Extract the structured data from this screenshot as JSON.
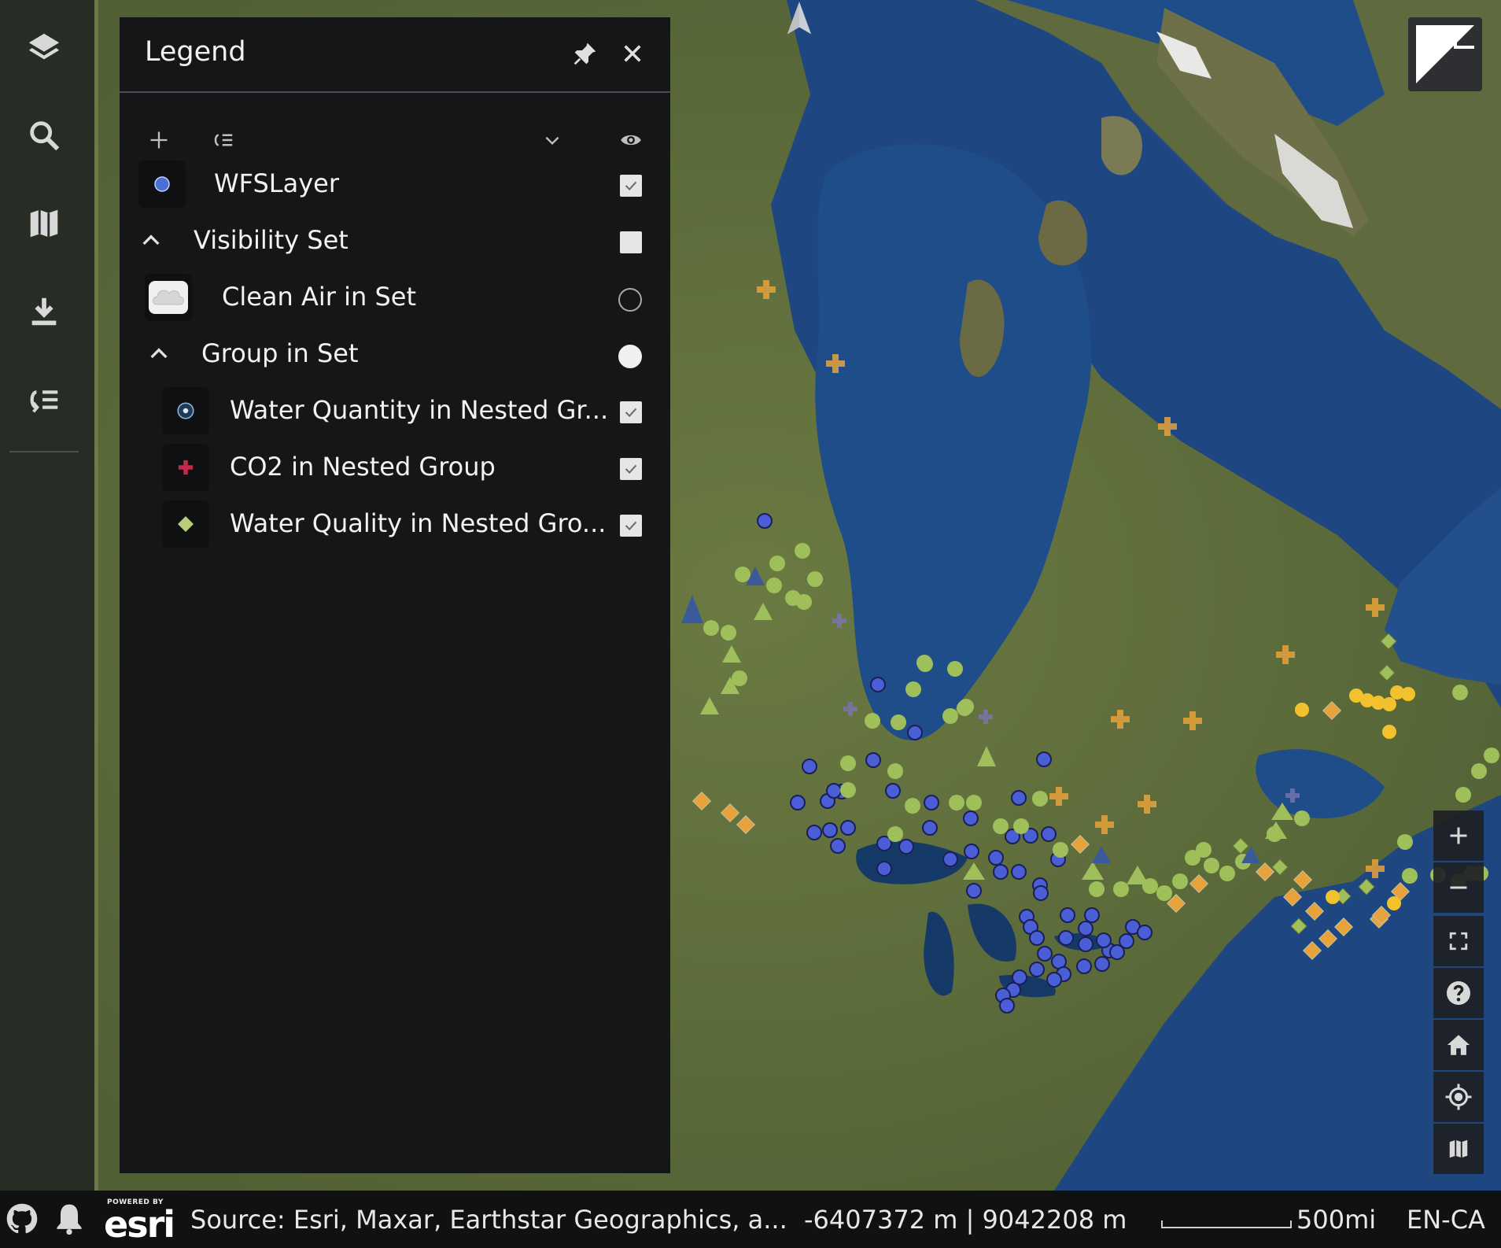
{
  "legend": {
    "title": "Legend",
    "layers": [
      {
        "label": "WFSLayer",
        "icon": "blue-circle-icon",
        "control": "checkbox",
        "checked": true
      },
      {
        "label": "Visibility Set",
        "icon": "chevron-up-icon",
        "control": "checkbox",
        "checked": true
      },
      {
        "label": "Clean Air in Set",
        "icon": "cloud-icon",
        "control": "radio",
        "checked": false
      },
      {
        "label": "Group in Set",
        "icon": "chevron-up-icon",
        "control": "radio",
        "checked": true
      },
      {
        "label": "Water Quantity in Nested Gr...",
        "icon": "target-dot-icon",
        "control": "checkbox",
        "checked": true
      },
      {
        "label": "CO2 in Nested Group",
        "icon": "red-cross-icon",
        "control": "checkbox",
        "checked": true
      },
      {
        "label": "Water Quality in Nested Gro...",
        "icon": "green-diamond-icon",
        "control": "checkbox",
        "checked": true
      }
    ]
  },
  "footer": {
    "attribution": "Source: Esri, Maxar, Earthstar Geographics, a...",
    "coordinates": "-6407372 m | 9042208 m",
    "scale": "500mi",
    "locale": "EN-CA",
    "esri_powered": "POWERED BY",
    "esri_name": "esri"
  },
  "colors": {
    "panel_bg": "#151618",
    "appbar_bg": "#14161a",
    "footer_bg": "#101113",
    "water": "#1f4d8a",
    "land": "#5a6b3a",
    "marker_blue": "#4a5fd6",
    "marker_green": "#9fbf5a",
    "marker_orange": "#e8a23c"
  }
}
